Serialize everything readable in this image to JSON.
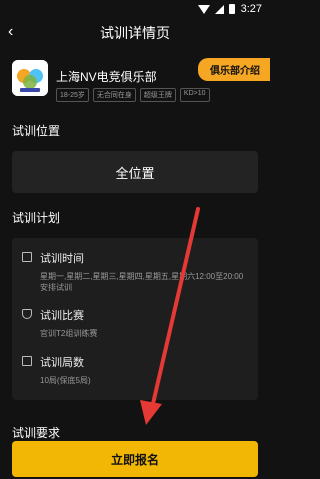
{
  "status": {
    "time": "3:27"
  },
  "nav": {
    "title": "试训详情页"
  },
  "club": {
    "name": "上海NV电竞俱乐部",
    "tags": [
      "18-25岁",
      "无合同在身",
      "超级王牌",
      "KD>10"
    ],
    "intro_button": "俱乐部介绍"
  },
  "location": {
    "title": "试训位置",
    "value": "全位置"
  },
  "plan": {
    "title": "试训计划",
    "items": [
      {
        "label": "试训时间",
        "value": "星期一,星期二,星期三,星期四,星期五,星期六12:00至20:00安排试训"
      },
      {
        "label": "试训比赛",
        "value": "官训T2组训练赛"
      },
      {
        "label": "试训局数",
        "value": "10局(保底5局)"
      }
    ]
  },
  "requirements": {
    "title": "试训要求"
  },
  "signup": {
    "label": "立即报名"
  },
  "colors": {
    "accent": "#f2b705",
    "intro": "#f5a623",
    "annotation_arrow": "#e53935"
  }
}
